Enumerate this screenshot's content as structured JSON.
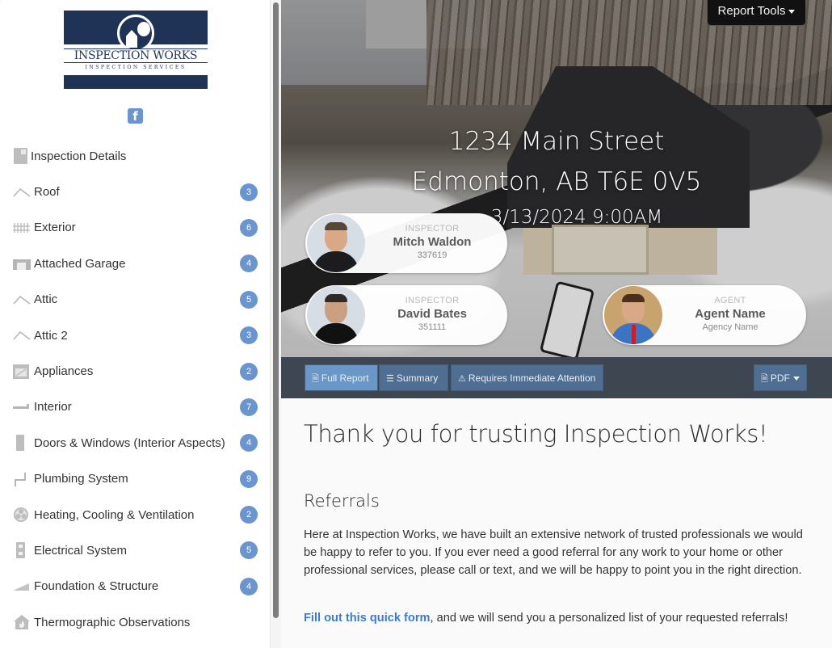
{
  "brand": {
    "name": "INSPECTION WORKS",
    "tagline": "INSPECTION SERVICES",
    "primary_color": "#1f3356",
    "accent_color": "#6a95cf",
    "social_icon": "facebook-icon",
    "social_glyph": "f"
  },
  "sidebar": {
    "items": [
      {
        "label": "Inspection Details",
        "icon": "document-icon",
        "count": null
      },
      {
        "label": "Roof",
        "icon": "roof-icon",
        "count": "3"
      },
      {
        "label": "Exterior",
        "icon": "fence-icon",
        "count": "6"
      },
      {
        "label": "Attached Garage",
        "icon": "garage-icon",
        "count": "4"
      },
      {
        "label": "Attic",
        "icon": "roof-icon",
        "count": "5"
      },
      {
        "label": "Attic 2",
        "icon": "roof-icon",
        "count": "3"
      },
      {
        "label": "Appliances",
        "icon": "oven-icon",
        "count": "2"
      },
      {
        "label": "Interior",
        "icon": "pipe-icon",
        "count": "7"
      },
      {
        "label": "Doors & Windows (Interior Aspects)",
        "icon": "door-icon",
        "count": "4"
      },
      {
        "label": "Plumbing System",
        "icon": "plumbing-icon",
        "count": "9"
      },
      {
        "label": "Heating, Cooling & Ventilation",
        "icon": "fan-icon",
        "count": "2"
      },
      {
        "label": "Electrical System",
        "icon": "outlet-icon",
        "count": "5"
      },
      {
        "label": "Foundation & Structure",
        "icon": "foundation-icon",
        "count": "4"
      },
      {
        "label": "Thermographic Observations",
        "icon": "thermal-house-icon",
        "count": null
      }
    ]
  },
  "hero": {
    "report_tools_label": "Report Tools",
    "address_line1": "1234 Main Street",
    "address_line2": "Edmonton, AB T6E 0V5",
    "datetime": "3/13/2024 9:00AM",
    "people": [
      {
        "role": "INSPECTOR",
        "name": "Mitch Waldon",
        "detail": "337619"
      },
      {
        "role": "INSPECTOR",
        "name": "David Bates",
        "detail": "351111"
      },
      {
        "role": "AGENT",
        "name": "Agent Name",
        "detail": "Agency Name"
      }
    ]
  },
  "toolbar": {
    "full_report": "Full Report",
    "summary": "Summary",
    "attention": "Requires Immediate Attention",
    "pdf": "PDF",
    "active_tab": "Full Report"
  },
  "content": {
    "title": "Thank you for trusting Inspection Works!",
    "section_title": "Referrals",
    "paragraph": "Here at Inspection Works, we have built an extensive network of trusted professionals we would be happy to refer to you. If you ever need a good referral for any work to your home or other professional services, please call or text, and we will be happy to point you in the right direction.",
    "link_text": "Fill out this quick form",
    "link_followup": ", and we will send you a personalized list of your requested referrals!"
  }
}
